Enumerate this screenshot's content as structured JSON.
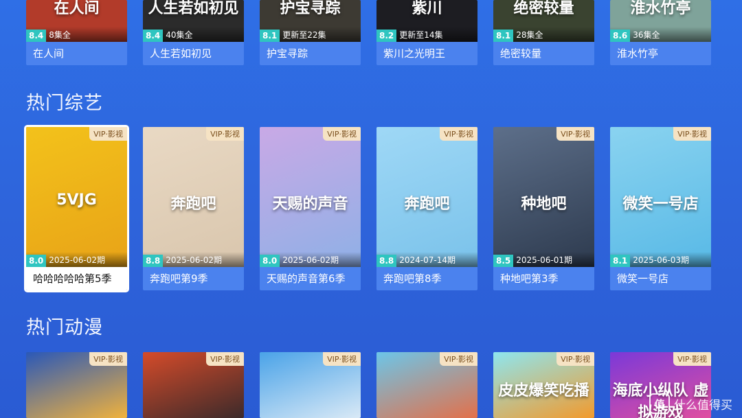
{
  "drama_row": {
    "items": [
      {
        "title": "在人间",
        "score": "8.4",
        "meta": "8集全",
        "poster_text": "在人间",
        "bg": "#b23b2a"
      },
      {
        "title": "人生若如初见",
        "score": "8.4",
        "meta": "40集全",
        "poster_text": "人生若如初见",
        "bg": "#2b2b2b"
      },
      {
        "title": "护宝寻踪",
        "score": "8.1",
        "meta": "更新至22集",
        "poster_text": "护宝寻踪",
        "bg": "#3d3a33"
      },
      {
        "title": "紫川之光明王",
        "score": "8.2",
        "meta": "更新至14集",
        "poster_text": "紫川",
        "bg": "#1d1d22"
      },
      {
        "title": "绝密较量",
        "score": "8.1",
        "meta": "28集全",
        "poster_text": "绝密较量",
        "bg": "#3a4330"
      },
      {
        "title": "淮水竹亭",
        "score": "8.6",
        "meta": "36集全",
        "poster_text": "淮水竹亭",
        "bg": "#7fa39a"
      }
    ]
  },
  "variety": {
    "title": "热门综艺",
    "items": [
      {
        "title": "哈哈哈哈哈第5季",
        "score": "8.0",
        "meta": "2025-06-02期",
        "vip": "VIP·影视",
        "poster_text": "5VJG",
        "bg": "#f3c21b",
        "bg2": "#e8a317"
      },
      {
        "title": "奔跑吧第9季",
        "score": "8.8",
        "meta": "2025-06-02期",
        "vip": "VIP·影视",
        "poster_text": "奔跑吧",
        "bg": "#e9d9c4",
        "bg2": "#d9c6ad"
      },
      {
        "title": "天赐的声音第6季",
        "score": "8.0",
        "meta": "2025-06-02期",
        "vip": "VIP·影视",
        "poster_text": "天赐的声音",
        "bg": "#c9a9e6",
        "bg2": "#8fb0e6"
      },
      {
        "title": "奔跑吧第8季",
        "score": "8.8",
        "meta": "2024-07-14期",
        "vip": "VIP·影视",
        "poster_text": "奔跑吧",
        "bg": "#9fd8f6",
        "bg2": "#7ac2ea"
      },
      {
        "title": "种地吧第3季",
        "score": "8.5",
        "meta": "2025-06-01期",
        "vip": "VIP·影视",
        "poster_text": "种地吧",
        "bg": "#5d6f8a",
        "bg2": "#2d3a4e"
      },
      {
        "title": "微笑一号店",
        "score": "8.1",
        "meta": "2025-06-03期",
        "vip": "VIP·影视",
        "poster_text": "微笑一号店",
        "bg": "#8ad3f0",
        "bg2": "#58b9e6"
      }
    ]
  },
  "anime": {
    "title": "热门动漫",
    "items": [
      {
        "vip": "VIP·影视",
        "poster_text": "",
        "bg": "#2a58b8",
        "bg2": "#f0b23d"
      },
      {
        "vip": "VIP·影视",
        "poster_text": "",
        "bg": "#d54b2a",
        "bg2": "#3c2a2a"
      },
      {
        "vip": "VIP·影视",
        "poster_text": "",
        "bg": "#4aa3e8",
        "bg2": "#d9e9f6"
      },
      {
        "vip": "VIP·影视",
        "poster_text": "",
        "bg": "#6cc6e9",
        "bg2": "#e3704a"
      },
      {
        "vip": "VIP·影视",
        "poster_text": "皮皮爆笑吃播",
        "bg": "#8ee6ef",
        "bg2": "#f29a2d"
      },
      {
        "vip": "VIP·影视",
        "poster_text": "海底小纵队 虚拟游戏",
        "bg": "#7b39d8",
        "bg2": "#e04fa0"
      }
    ]
  },
  "watermark": {
    "logo": "值",
    "text": "什么值得买"
  }
}
